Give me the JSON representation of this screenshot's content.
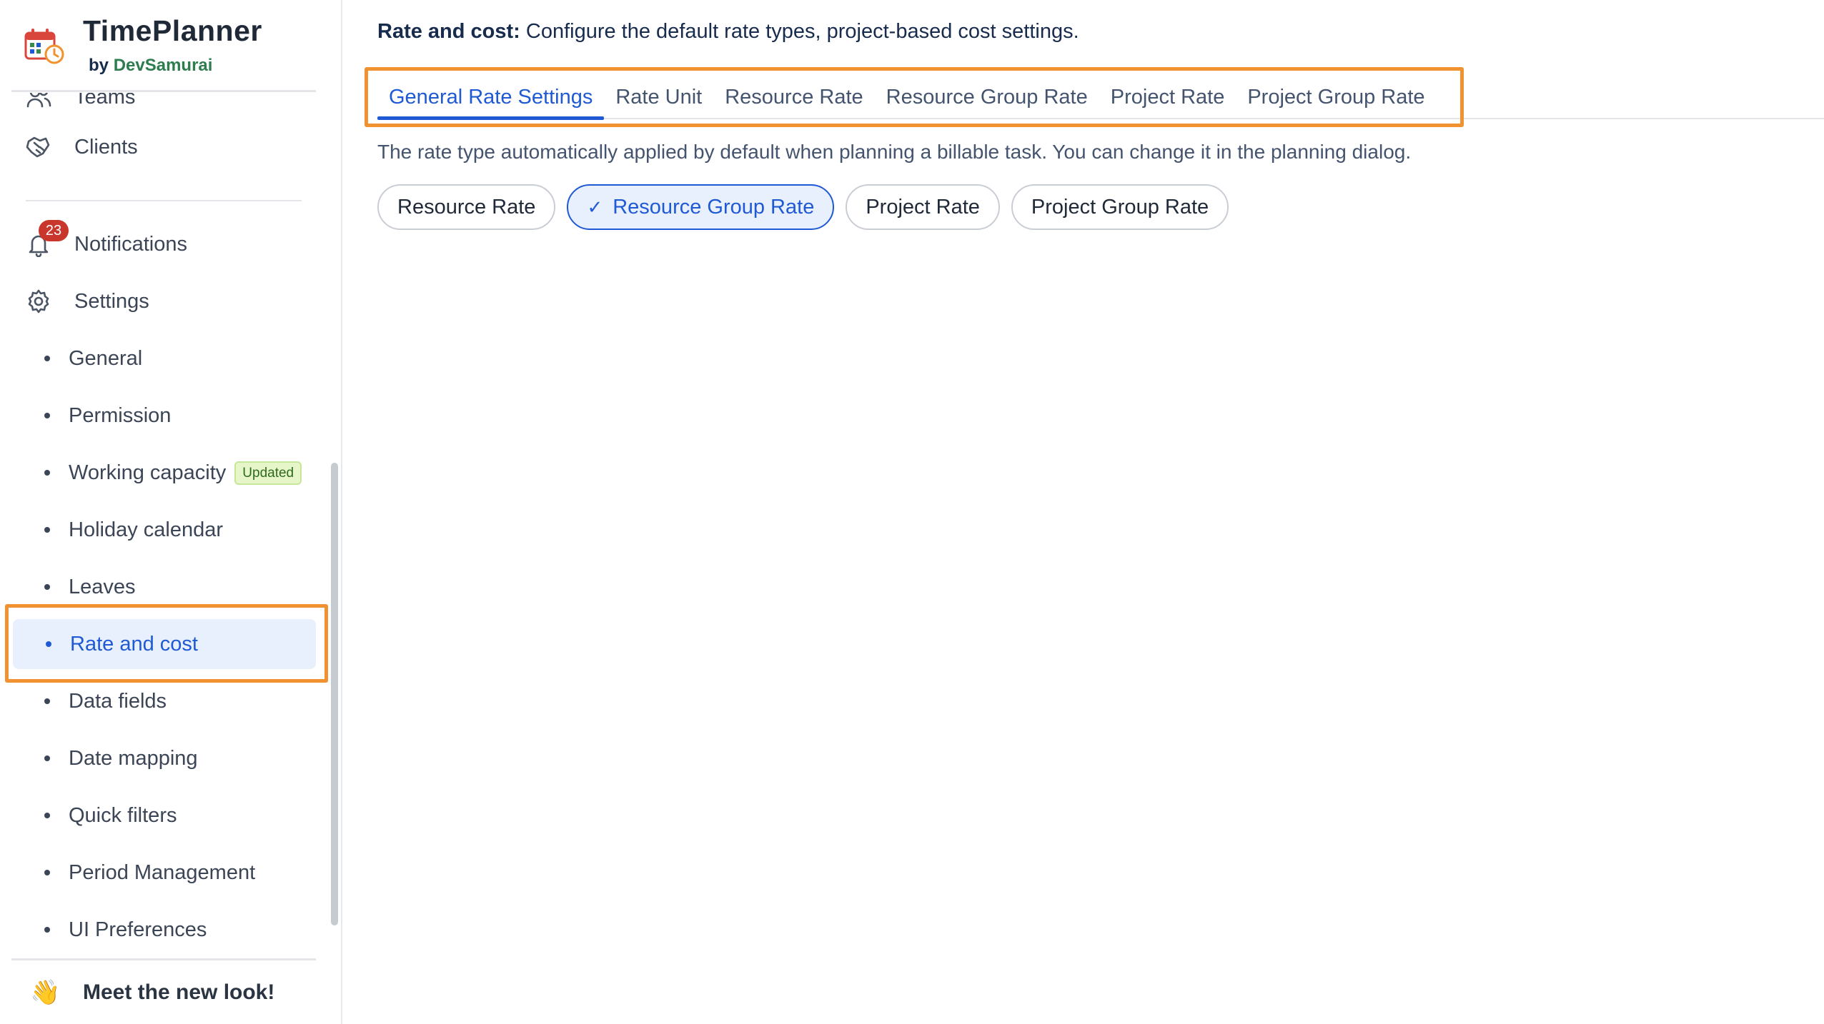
{
  "brand": {
    "title": "TimePlanner",
    "by": "by",
    "org": "DevSamurai"
  },
  "sidebar": {
    "top_items": [
      {
        "label": "Teams",
        "icon": "teams-icon"
      },
      {
        "label": "Clients",
        "icon": "clients-icon"
      }
    ],
    "notifications": {
      "label": "Notifications",
      "count": "23",
      "icon": "bell-icon"
    },
    "settings": {
      "label": "Settings",
      "icon": "gear-icon"
    },
    "sub_items": [
      {
        "label": "General"
      },
      {
        "label": "Permission"
      },
      {
        "label": "Working capacity",
        "tag": "Updated"
      },
      {
        "label": "Holiday calendar"
      },
      {
        "label": "Leaves"
      },
      {
        "label": "Rate and cost",
        "active": true
      },
      {
        "label": "Data fields"
      },
      {
        "label": "Date mapping"
      },
      {
        "label": "Quick filters"
      },
      {
        "label": "Period Management"
      },
      {
        "label": "UI Preferences"
      }
    ],
    "footer": {
      "emoji": "👋",
      "label": "Meet the new look!"
    }
  },
  "main": {
    "intro_bold": "Rate and cost:",
    "intro_text": " Configure the default rate types, project-based cost settings.",
    "tabs": [
      {
        "label": "General Rate Settings",
        "active": true
      },
      {
        "label": "Rate Unit"
      },
      {
        "label": "Resource Rate"
      },
      {
        "label": "Resource Group Rate"
      },
      {
        "label": "Project Rate"
      },
      {
        "label": "Project Group Rate"
      }
    ],
    "description": "The rate type automatically applied by default when planning a billable task. You can change it in the planning dialog.",
    "rate_options": [
      {
        "label": "Resource Rate"
      },
      {
        "label": "Resource Group Rate",
        "selected": true,
        "check": "✓"
      },
      {
        "label": "Project Rate"
      },
      {
        "label": "Project Group Rate"
      }
    ]
  },
  "colors": {
    "accent": "#1f5ad4",
    "highlight": "#f0922f",
    "badge": "#c9372c"
  }
}
